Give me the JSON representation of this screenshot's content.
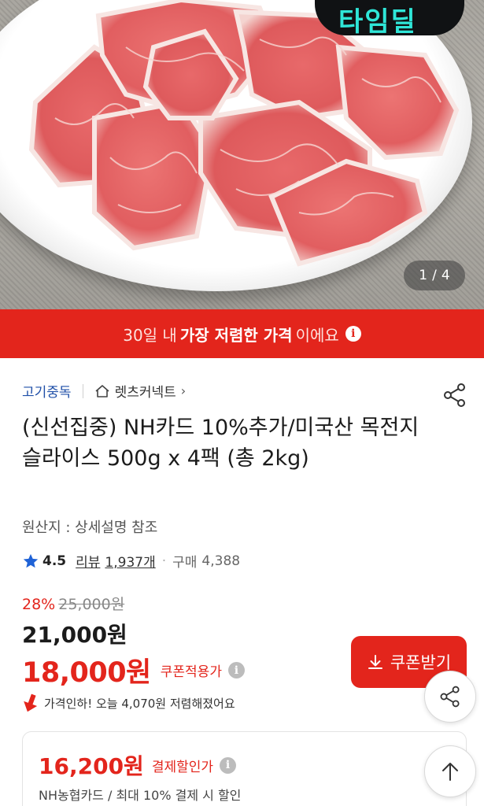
{
  "gallery": {
    "current": "1",
    "separator": "/",
    "total": "4",
    "badge_text": "타임딜"
  },
  "promo": {
    "text_before": "30일 내",
    "text_bold": "가장 저렴한 가격",
    "text_after": "이에요",
    "info_icon": "i"
  },
  "product": {
    "category": "고기중독",
    "shop": "렛츠커넥트",
    "title": "(신선집중) NH카드 10%추가/미국산 목전지 슬라이스 500g x 4팩 (총 2kg)",
    "origin": "원산지 : 상세설명 참조",
    "rating": "4.5",
    "review_label": "리뷰",
    "review_count": "1,937개",
    "buy_label": "구매",
    "buy_count": "4,388"
  },
  "pricing": {
    "discount_rate": "28%",
    "original_price": "25,000원",
    "sale_price": "21,000원",
    "coupon_price": "18,000원",
    "coupon_label": "쿠폰적용가",
    "coupon_button": "쿠폰받기",
    "price_drop_text": "가격인하! 오늘 4,070원 저렴해졌어요"
  },
  "payment": {
    "price": "16,200원",
    "label": "결제할인가",
    "description": "NH농협카드 / 최대 10% 결제 시 할인"
  },
  "colors": {
    "accent_red": "#e3251c",
    "link_blue": "#1f4fa8",
    "star_blue": "#1f62d6"
  },
  "icons": {
    "share": "share-icon",
    "home": "home-icon",
    "star": "star-icon",
    "download": "download-icon",
    "arrow_up": "arrow-up-icon",
    "info": "info-icon"
  }
}
